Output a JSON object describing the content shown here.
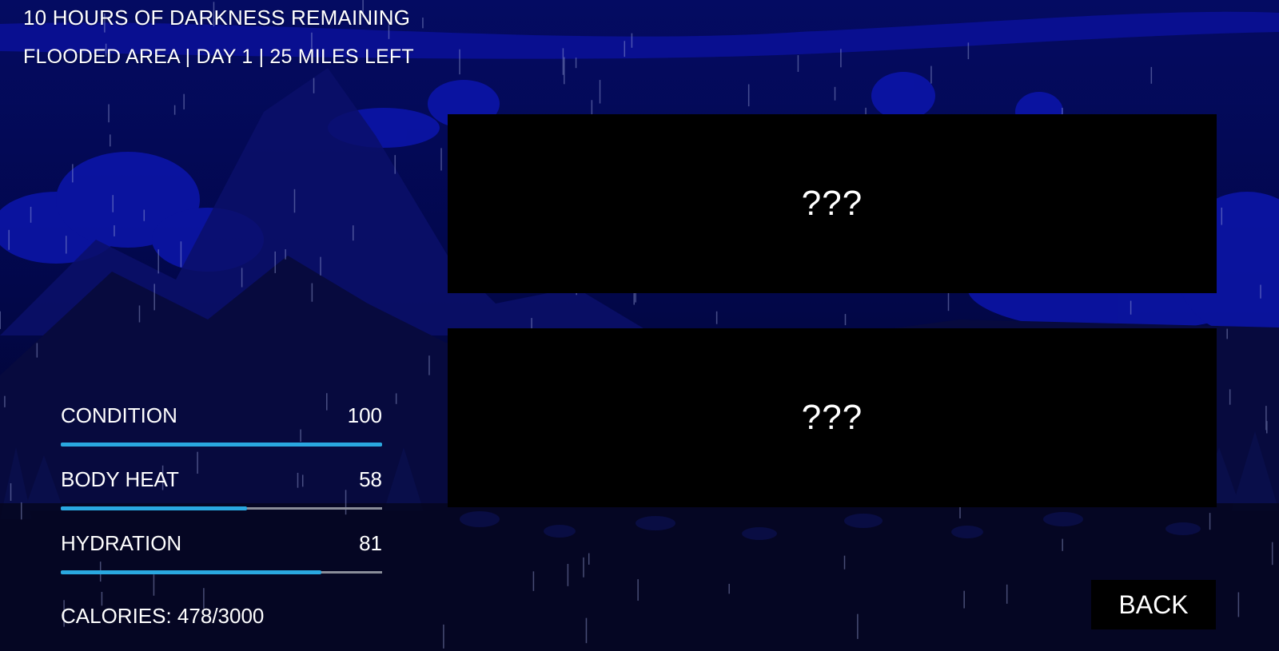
{
  "hud": {
    "darkness_text": "10 HOURS OF DARKNESS REMAINING",
    "location_text": "FLOODED AREA | DAY 1 | 25 MILES LEFT"
  },
  "stats": [
    {
      "label": "CONDITION",
      "value": "100",
      "fraction": 1.0
    },
    {
      "label": "BODY HEAT",
      "value": "58",
      "fraction": 0.58
    },
    {
      "label": "HYDRATION",
      "value": "81",
      "fraction": 0.81
    }
  ],
  "calories_text": "CALORIES: 478/3000",
  "choices": [
    {
      "label": "???"
    },
    {
      "label": "???"
    }
  ],
  "back_label": "BACK",
  "colors": {
    "sky_top": "#030a5a",
    "sky_band": "#0a12a0",
    "ground": "#05061e",
    "bar_fill": "#2aa8e0",
    "bar_track": "#8a8d99",
    "panel": "#000000"
  }
}
